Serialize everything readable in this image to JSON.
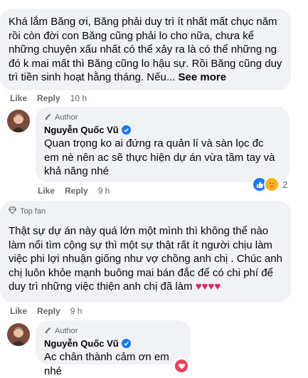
{
  "comment1": {
    "text": "Khá lắm Băng ơi, Băng phải duy trì ít nhất mất chục năm rồi còn đời con Băng cũng phải lo cho nữa, chưa kể những chuyện xấu nhất có thể xảy ra là có thể những ng đó k mai mất thì Băng cũng lo hậu sự. Rồi Băng cũng duy trì tiền sinh hoạt hằng tháng. Nếu... ",
    "see_more": "See more",
    "like": "Like",
    "reply": "Reply",
    "time": "10 h"
  },
  "reply1": {
    "badge": "Author",
    "author": "Nguyễn Quốc Vũ",
    "text": "Quan trọng ko ai đứng ra quản lí và sàn lọc đc em nè nên ac sẽ thực hiện dự án vừa tầm tay và khả năng nhé",
    "like": "Like",
    "reply": "Reply",
    "time": "9 h",
    "reaction_count": "2",
    "reaction_icons": [
      "like-icon",
      "care-icon"
    ]
  },
  "comment2": {
    "badge": "Top fan",
    "text": "Thật sự dự án này quá lớn một mình thì không thể nào làm nổi tìm cộng sự thì một sự thật rất ít người chịu làm việc phi lợi nhuận giống như vợ chồng anh chị . Chúc anh chị luôn khỏe mạnh buông mai bán đắc để có chi phí để duy trì những việc thiện anh chị đã làm ",
    "hearts": "♥♥♥♥",
    "like": "Like",
    "reply": "Reply",
    "time": "9 h"
  },
  "reply2": {
    "badge": "Author",
    "author": "Nguyễn Quốc Vũ",
    "text": "Ac chân thành cảm ơn em nhé",
    "reaction_icon": "love-icon"
  },
  "colors": {
    "bubble": "#f0f2f5",
    "secondary_text": "#65676b",
    "facebook_blue": "#1877f2",
    "love_red": "#f33e58"
  }
}
